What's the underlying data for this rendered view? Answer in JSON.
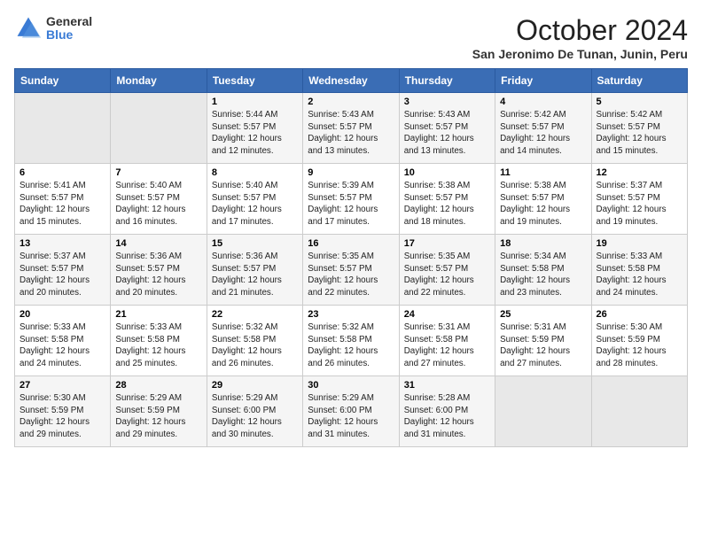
{
  "logo": {
    "general": "General",
    "blue": "Blue"
  },
  "header": {
    "month": "October 2024",
    "location": "San Jeronimo De Tunan, Junin, Peru"
  },
  "weekdays": [
    "Sunday",
    "Monday",
    "Tuesday",
    "Wednesday",
    "Thursday",
    "Friday",
    "Saturday"
  ],
  "weeks": [
    [
      {
        "day": "",
        "empty": true
      },
      {
        "day": "",
        "empty": true
      },
      {
        "day": "1",
        "sunrise": "Sunrise: 5:44 AM",
        "sunset": "Sunset: 5:57 PM",
        "daylight": "Daylight: 12 hours and 12 minutes."
      },
      {
        "day": "2",
        "sunrise": "Sunrise: 5:43 AM",
        "sunset": "Sunset: 5:57 PM",
        "daylight": "Daylight: 12 hours and 13 minutes."
      },
      {
        "day": "3",
        "sunrise": "Sunrise: 5:43 AM",
        "sunset": "Sunset: 5:57 PM",
        "daylight": "Daylight: 12 hours and 13 minutes."
      },
      {
        "day": "4",
        "sunrise": "Sunrise: 5:42 AM",
        "sunset": "Sunset: 5:57 PM",
        "daylight": "Daylight: 12 hours and 14 minutes."
      },
      {
        "day": "5",
        "sunrise": "Sunrise: 5:42 AM",
        "sunset": "Sunset: 5:57 PM",
        "daylight": "Daylight: 12 hours and 15 minutes."
      }
    ],
    [
      {
        "day": "6",
        "sunrise": "Sunrise: 5:41 AM",
        "sunset": "Sunset: 5:57 PM",
        "daylight": "Daylight: 12 hours and 15 minutes."
      },
      {
        "day": "7",
        "sunrise": "Sunrise: 5:40 AM",
        "sunset": "Sunset: 5:57 PM",
        "daylight": "Daylight: 12 hours and 16 minutes."
      },
      {
        "day": "8",
        "sunrise": "Sunrise: 5:40 AM",
        "sunset": "Sunset: 5:57 PM",
        "daylight": "Daylight: 12 hours and 17 minutes."
      },
      {
        "day": "9",
        "sunrise": "Sunrise: 5:39 AM",
        "sunset": "Sunset: 5:57 PM",
        "daylight": "Daylight: 12 hours and 17 minutes."
      },
      {
        "day": "10",
        "sunrise": "Sunrise: 5:38 AM",
        "sunset": "Sunset: 5:57 PM",
        "daylight": "Daylight: 12 hours and 18 minutes."
      },
      {
        "day": "11",
        "sunrise": "Sunrise: 5:38 AM",
        "sunset": "Sunset: 5:57 PM",
        "daylight": "Daylight: 12 hours and 19 minutes."
      },
      {
        "day": "12",
        "sunrise": "Sunrise: 5:37 AM",
        "sunset": "Sunset: 5:57 PM",
        "daylight": "Daylight: 12 hours and 19 minutes."
      }
    ],
    [
      {
        "day": "13",
        "sunrise": "Sunrise: 5:37 AM",
        "sunset": "Sunset: 5:57 PM",
        "daylight": "Daylight: 12 hours and 20 minutes."
      },
      {
        "day": "14",
        "sunrise": "Sunrise: 5:36 AM",
        "sunset": "Sunset: 5:57 PM",
        "daylight": "Daylight: 12 hours and 20 minutes."
      },
      {
        "day": "15",
        "sunrise": "Sunrise: 5:36 AM",
        "sunset": "Sunset: 5:57 PM",
        "daylight": "Daylight: 12 hours and 21 minutes."
      },
      {
        "day": "16",
        "sunrise": "Sunrise: 5:35 AM",
        "sunset": "Sunset: 5:57 PM",
        "daylight": "Daylight: 12 hours and 22 minutes."
      },
      {
        "day": "17",
        "sunrise": "Sunrise: 5:35 AM",
        "sunset": "Sunset: 5:57 PM",
        "daylight": "Daylight: 12 hours and 22 minutes."
      },
      {
        "day": "18",
        "sunrise": "Sunrise: 5:34 AM",
        "sunset": "Sunset: 5:58 PM",
        "daylight": "Daylight: 12 hours and 23 minutes."
      },
      {
        "day": "19",
        "sunrise": "Sunrise: 5:33 AM",
        "sunset": "Sunset: 5:58 PM",
        "daylight": "Daylight: 12 hours and 24 minutes."
      }
    ],
    [
      {
        "day": "20",
        "sunrise": "Sunrise: 5:33 AM",
        "sunset": "Sunset: 5:58 PM",
        "daylight": "Daylight: 12 hours and 24 minutes."
      },
      {
        "day": "21",
        "sunrise": "Sunrise: 5:33 AM",
        "sunset": "Sunset: 5:58 PM",
        "daylight": "Daylight: 12 hours and 25 minutes."
      },
      {
        "day": "22",
        "sunrise": "Sunrise: 5:32 AM",
        "sunset": "Sunset: 5:58 PM",
        "daylight": "Daylight: 12 hours and 26 minutes."
      },
      {
        "day": "23",
        "sunrise": "Sunrise: 5:32 AM",
        "sunset": "Sunset: 5:58 PM",
        "daylight": "Daylight: 12 hours and 26 minutes."
      },
      {
        "day": "24",
        "sunrise": "Sunrise: 5:31 AM",
        "sunset": "Sunset: 5:58 PM",
        "daylight": "Daylight: 12 hours and 27 minutes."
      },
      {
        "day": "25",
        "sunrise": "Sunrise: 5:31 AM",
        "sunset": "Sunset: 5:59 PM",
        "daylight": "Daylight: 12 hours and 27 minutes."
      },
      {
        "day": "26",
        "sunrise": "Sunrise: 5:30 AM",
        "sunset": "Sunset: 5:59 PM",
        "daylight": "Daylight: 12 hours and 28 minutes."
      }
    ],
    [
      {
        "day": "27",
        "sunrise": "Sunrise: 5:30 AM",
        "sunset": "Sunset: 5:59 PM",
        "daylight": "Daylight: 12 hours and 29 minutes."
      },
      {
        "day": "28",
        "sunrise": "Sunrise: 5:29 AM",
        "sunset": "Sunset: 5:59 PM",
        "daylight": "Daylight: 12 hours and 29 minutes."
      },
      {
        "day": "29",
        "sunrise": "Sunrise: 5:29 AM",
        "sunset": "Sunset: 6:00 PM",
        "daylight": "Daylight: 12 hours and 30 minutes."
      },
      {
        "day": "30",
        "sunrise": "Sunrise: 5:29 AM",
        "sunset": "Sunset: 6:00 PM",
        "daylight": "Daylight: 12 hours and 31 minutes."
      },
      {
        "day": "31",
        "sunrise": "Sunrise: 5:28 AM",
        "sunset": "Sunset: 6:00 PM",
        "daylight": "Daylight: 12 hours and 31 minutes."
      },
      {
        "day": "",
        "empty": true
      },
      {
        "day": "",
        "empty": true
      }
    ]
  ]
}
